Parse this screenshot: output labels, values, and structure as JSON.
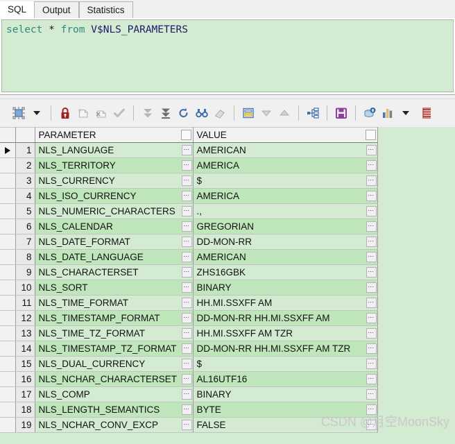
{
  "tabs": [
    {
      "label": "SQL",
      "active": true
    },
    {
      "label": "Output",
      "active": false
    },
    {
      "label": "Statistics",
      "active": false
    }
  ],
  "editor": {
    "keyword1": "select",
    "operator": "*",
    "keyword2": "from",
    "identifier": "V$NLS_PARAMETERS",
    "full_text": "select * from V$NLS_PARAMETERS"
  },
  "toolbar": {
    "items": [
      {
        "name": "grid-view-icon",
        "title": "Grid view"
      },
      {
        "name": "grid-view-dropdown-icon",
        "title": "Grid view options"
      },
      {
        "name": "lock-icon",
        "title": "Lock record"
      },
      {
        "name": "insert-record-icon",
        "title": "Insert record"
      },
      {
        "name": "delete-record-icon",
        "title": "Delete record"
      },
      {
        "name": "post-changes-icon",
        "title": "Post changes"
      },
      {
        "name": "fetch-next-page-icon",
        "title": "Fetch next page"
      },
      {
        "name": "fetch-all-rows-icon",
        "title": "Fetch all rows"
      },
      {
        "name": "refresh-icon",
        "title": "Refresh"
      },
      {
        "name": "find-icon",
        "title": "Find"
      },
      {
        "name": "clear-filter-icon",
        "title": "Clear filter"
      },
      {
        "name": "single-record-view-icon",
        "title": "Single record view"
      },
      {
        "name": "sort-descending-icon",
        "title": "Sort descending"
      },
      {
        "name": "sort-ascending-icon",
        "title": "Sort ascending"
      },
      {
        "name": "hierarchy-icon",
        "title": "Data hierarchy"
      },
      {
        "name": "save-icon",
        "title": "Export / save"
      },
      {
        "name": "export-database-icon",
        "title": "Export to database"
      },
      {
        "name": "chart-icon",
        "title": "Chart"
      },
      {
        "name": "chart-dropdown-icon",
        "title": "Chart options"
      },
      {
        "name": "table-grid-icon",
        "title": "Table"
      }
    ]
  },
  "grid": {
    "columns": [
      "PARAMETER",
      "VALUE"
    ],
    "ellipsis_label": "...",
    "rows": [
      {
        "n": "1",
        "parameter": "NLS_LANGUAGE",
        "value": "AMERICAN"
      },
      {
        "n": "2",
        "parameter": "NLS_TERRITORY",
        "value": "AMERICA"
      },
      {
        "n": "3",
        "parameter": "NLS_CURRENCY",
        "value": "$"
      },
      {
        "n": "4",
        "parameter": "NLS_ISO_CURRENCY",
        "value": "AMERICA"
      },
      {
        "n": "5",
        "parameter": "NLS_NUMERIC_CHARACTERS",
        "value": ".,"
      },
      {
        "n": "6",
        "parameter": "NLS_CALENDAR",
        "value": "GREGORIAN"
      },
      {
        "n": "7",
        "parameter": "NLS_DATE_FORMAT",
        "value": "DD-MON-RR"
      },
      {
        "n": "8",
        "parameter": "NLS_DATE_LANGUAGE",
        "value": "AMERICAN"
      },
      {
        "n": "9",
        "parameter": "NLS_CHARACTERSET",
        "value": "ZHS16GBK"
      },
      {
        "n": "10",
        "parameter": "NLS_SORT",
        "value": "BINARY"
      },
      {
        "n": "11",
        "parameter": "NLS_TIME_FORMAT",
        "value": "HH.MI.SSXFF AM"
      },
      {
        "n": "12",
        "parameter": "NLS_TIMESTAMP_FORMAT",
        "value": "DD-MON-RR HH.MI.SSXFF AM"
      },
      {
        "n": "13",
        "parameter": "NLS_TIME_TZ_FORMAT",
        "value": "HH.MI.SSXFF AM TZR"
      },
      {
        "n": "14",
        "parameter": "NLS_TIMESTAMP_TZ_FORMAT",
        "value": "DD-MON-RR HH.MI.SSXFF AM TZR"
      },
      {
        "n": "15",
        "parameter": "NLS_DUAL_CURRENCY",
        "value": "$"
      },
      {
        "n": "16",
        "parameter": "NLS_NCHAR_CHARACTERSET",
        "value": "AL16UTF16"
      },
      {
        "n": "17",
        "parameter": "NLS_COMP",
        "value": "BINARY"
      },
      {
        "n": "18",
        "parameter": "NLS_LENGTH_SEMANTICS",
        "value": "BYTE"
      },
      {
        "n": "19",
        "parameter": "NLS_NCHAR_CONV_EXCP",
        "value": "FALSE"
      }
    ],
    "selected_row": 1
  },
  "watermark": {
    "text": "CSDN @月空MoonSky"
  },
  "colors": {
    "grid_row": "#d3ebd0",
    "grid_row_alt": "#bfe5bb",
    "editor_bg": "#d3ebd0",
    "keyword": "#2e8b84",
    "identifier": "#1b1b6e",
    "lock_red": "#a32020",
    "accent_blue": "#3f72b0",
    "save_purple": "#8e3f9e"
  }
}
